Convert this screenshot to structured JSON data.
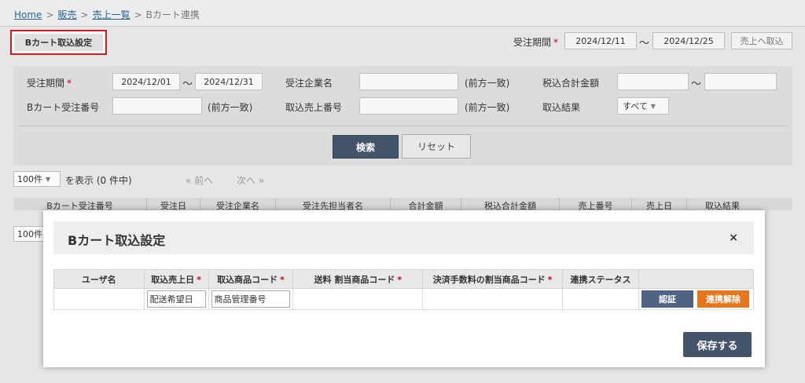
{
  "breadcrumb": {
    "home": "Home",
    "sales": "販売",
    "sales_list": "売上一覧",
    "current": "Bカート連携",
    "sep": ">"
  },
  "topbar": {
    "setting_button": "Bカート取込設定",
    "period_label": "受注期間",
    "required_mark": "*",
    "date_from": "2024/12/11",
    "tilde": "〜",
    "date_to": "2024/12/25",
    "import_button": "売上へ取込"
  },
  "search": {
    "order_period_label": "受注期間",
    "required_mark": "*",
    "order_from": "2024/12/01",
    "tilde": "〜",
    "order_to": "2024/12/31",
    "company_label": "受注企業名",
    "company_value": "",
    "company_note": "(前方一致)",
    "total_tax_label": "税込合計金額",
    "total_tax_from": "",
    "total_tax_tilde": "〜",
    "total_tax_to": "",
    "bcart_no_label": "Bカート受注番号",
    "bcart_no_value": "",
    "bcart_no_note": "(前方一致)",
    "sales_no_label": "取込売上番号",
    "sales_no_value": "",
    "sales_no_note": "(前方一致)",
    "result_label": "取込結果",
    "result_value": "すべて",
    "search_button": "検索",
    "reset_button": "リセット"
  },
  "pager": {
    "per_page": "100件",
    "display_text": "を表示 (0 件中)",
    "prev": "« 前へ",
    "next": "次へ »",
    "per_page_bottom": "100件"
  },
  "grid": {
    "headers": [
      "Bカート受注番号",
      "受注日",
      "受注企業名",
      "受注先担当者名",
      "合計金額",
      "税込合計金額",
      "売上番号",
      "売上日",
      "取込結果"
    ]
  },
  "modal": {
    "title": "Bカート取込設定",
    "close": "×",
    "table": {
      "headers": [
        "ユーザ名",
        "取込売上日",
        "取込商品コード",
        "送料 割当商品コード",
        "決済手数料の割当商品コード",
        "連携ステータス"
      ],
      "required_mark": "*",
      "row": {
        "user": "",
        "sales_date": "配送希望日",
        "product_code": "商品管理番号",
        "shipping_code": "",
        "fee_code": "",
        "status": ""
      }
    },
    "auth_button": "認証",
    "unlink_button": "連携解除",
    "save_button": "保存する"
  },
  "colors": {
    "primary_button": "#44546a",
    "unlink_button": "#e4761e",
    "highlight_border": "#e0161e",
    "required": "#d0021b"
  }
}
